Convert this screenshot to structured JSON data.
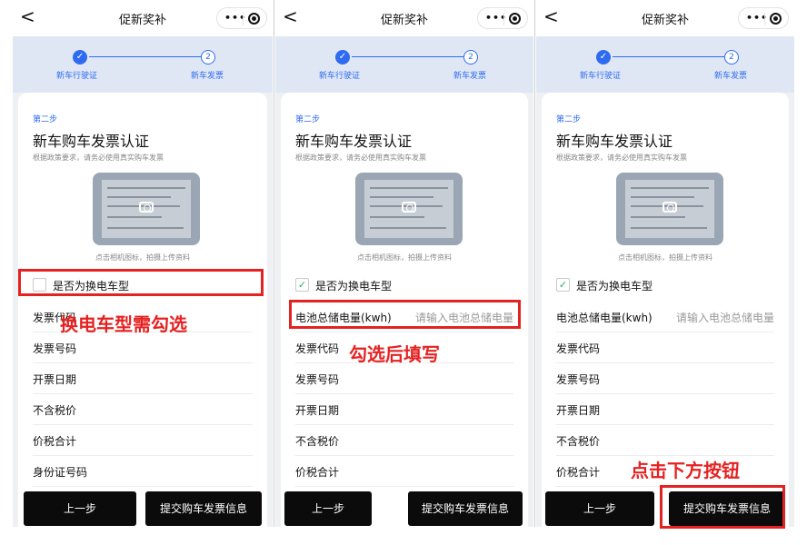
{
  "nav": {
    "back": "<",
    "title": "促新奖补",
    "menu_dots": "•••"
  },
  "stepper": {
    "step1_check": "✓",
    "step1_label": "新车行驶证",
    "step2_num": "2",
    "step2_label": "新车发票"
  },
  "form": {
    "step_tag": "第二步",
    "title": "新车购车发票认证",
    "hint": "根据政策要求，请务必使用真实购车发票",
    "upload_caption": "点击相机图标，拍摄上传资料",
    "swap_label": "是否为换电车型",
    "check_mark": "✓",
    "battery": {
      "label": "电池总储电量(kwh)",
      "placeholder": "请输入电池总储电量"
    },
    "fields": {
      "invoice_code": "发票代码",
      "invoice_no": "发票号码",
      "issue_date": "开票日期",
      "price_ex_tax": "不含税价",
      "total_tax": "价税合计",
      "id_no": "身份证号码"
    }
  },
  "buttons": {
    "prev": "上一步",
    "submit": "提交购车发票信息"
  },
  "annotations": {
    "note1": "换电车型需勾选",
    "note2": "勾选后填写",
    "note3": "点击下方按钮"
  },
  "colors": {
    "accent": "#2f6bf0",
    "highlight": "#e52222",
    "check": "#2aae67",
    "button": "#0b0b0b"
  },
  "panels": [
    {
      "swap_checked": false,
      "battery_shown": false
    },
    {
      "swap_checked": true,
      "battery_shown": true
    },
    {
      "swap_checked": true,
      "battery_shown": true
    }
  ]
}
